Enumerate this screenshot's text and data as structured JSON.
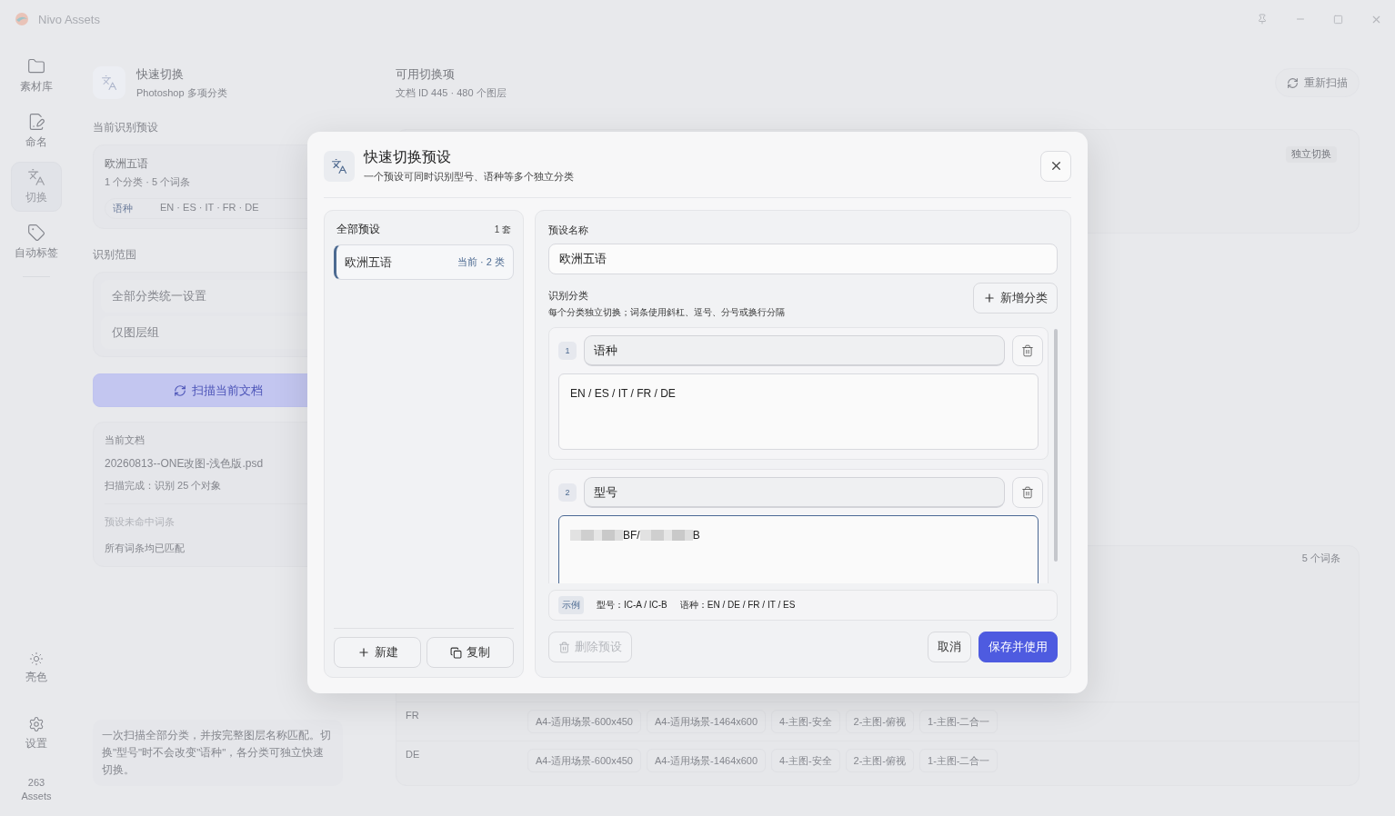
{
  "window": {
    "title": "Nivo Assets"
  },
  "sidebar": {
    "items": [
      {
        "label": "素材库",
        "kind": "folder",
        "selected": false
      },
      {
        "label": "命名",
        "kind": "rename",
        "selected": false
      },
      {
        "label": "切换",
        "kind": "switch",
        "selected": true
      },
      {
        "label": "自动标签",
        "kind": "tag",
        "selected": false
      }
    ],
    "bottom": [
      {
        "label": "亮色",
        "kind": "sun"
      },
      {
        "label": "设置",
        "kind": "gear"
      }
    ],
    "asset_count": "263",
    "asset_unit": "Assets"
  },
  "left": {
    "title": "快速切换",
    "subtitle": "Photoshop 多项分类",
    "preset_label": "当前识别预设",
    "preset": {
      "name": "欧洲五语",
      "summary": "1 个分类 · 5 个词条",
      "category": "语种",
      "terms": "EN · ES · IT · FR · DE"
    },
    "range_label": "识别范围",
    "range_options": [
      "全部分类统一设置",
      "仅图层组"
    ],
    "scan_button": "扫描当前文档",
    "document": {
      "label": "当前文档",
      "filename": "20260813--ONE改图-浅色版.psd",
      "status": "扫描完成：识别 25 个对象",
      "missing_label": "预设未命中词条",
      "missing_status": "所有词条均已匹配"
    },
    "note": "一次扫描全部分类，并按完整图层名称匹配。切换\"型号\"时不会改变\"语种\"，各分类可独立快速切换。"
  },
  "right": {
    "title": "可用切换项",
    "subtitle": "文档 ID 445 · 480 个图层",
    "rescan_button": "重新扫描",
    "switch_badge": "独立切换",
    "term_count": "5 个词条",
    "rows": [
      {
        "label": "FR",
        "chips": [
          "A4-适用场景-600x450",
          "A4-适用场景-1464x600",
          "4-主图-安全",
          "2-主图-俯视",
          "1-主图-二合一"
        ]
      },
      {
        "label": "DE",
        "chips": [
          "A4-适用场景-600x450",
          "A4-适用场景-1464x600",
          "4-主图-安全",
          "2-主图-俯视",
          "1-主图-二合一"
        ]
      }
    ]
  },
  "dialog": {
    "title": "快速切换预设",
    "subtitle": "一个预设可同时识别型号、语种等多个独立分类",
    "presets": {
      "title": "全部预设",
      "count": "1 套",
      "items": [
        {
          "name": "欧洲五语",
          "meta": "当前 · 2 类",
          "selected": true
        }
      ]
    },
    "new_button": "新建",
    "copy_button": "复制",
    "form": {
      "name_label": "预设名称",
      "name_value": "欧洲五语",
      "categories_label": "识别分类",
      "categories_hint": "每个分类独立切换；词条使用斜杠、逗号、分号或换行分隔",
      "add_button": "新增分类",
      "categories": [
        {
          "index": "1",
          "name": "语种",
          "terms": [
            "EN / ES / IT / FR / DE"
          ],
          "redacted": false,
          "focused": false
        },
        {
          "index": "2",
          "name": "型号",
          "terms": [
            "BF/",
            "B"
          ],
          "redacted": true,
          "focused": true
        }
      ],
      "example": {
        "badge": "示例",
        "items": [
          "型号：IC-A / IC-B",
          "语种：EN / DE / FR / IT / ES"
        ]
      }
    },
    "delete_button": {
      "label": "删除预设",
      "disabled": true
    },
    "cancel_button": "取消",
    "save_button": "保存并使用"
  }
}
